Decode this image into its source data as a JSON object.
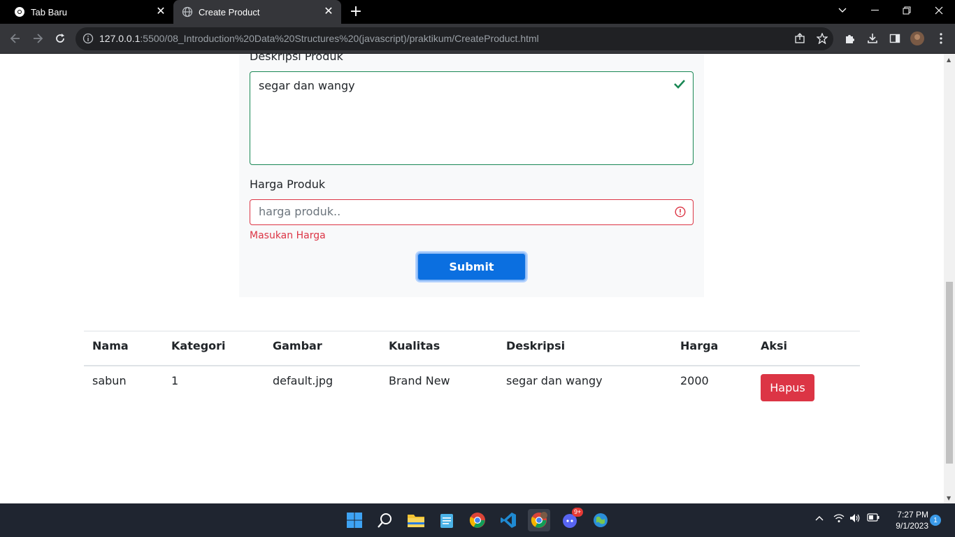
{
  "browser": {
    "tabs": [
      {
        "label": "Tab Baru"
      },
      {
        "label": "Create Product"
      }
    ],
    "url_host": "127.0.0.1",
    "url_rest": ":5500/08_Introduction%20Data%20Structures%20(javascript)/praktikum/CreateProduct.html"
  },
  "form": {
    "desc_label": "Deskripsi Produk",
    "desc_value": "segar dan wangy",
    "price_label": "Harga Produk",
    "price_placeholder": "harga produk..",
    "price_feedback": "Masukan Harga",
    "submit_label": "Submit",
    "colors": {
      "valid": "#198754",
      "invalid": "#dc3545",
      "primary": "#0b6fe0"
    }
  },
  "table": {
    "headers": [
      "Nama",
      "Kategori",
      "Gambar",
      "Kualitas",
      "Deskripsi",
      "Harga",
      "Aksi"
    ],
    "rows": [
      {
        "nama": "sabun",
        "kategori": "1",
        "gambar": "default.jpg",
        "kualitas": "Brand New",
        "deskripsi": "segar dan wangy",
        "harga": "2000",
        "aksi": "Hapus"
      }
    ]
  },
  "taskbar": {
    "time": "7:27 PM",
    "date": "9/1/2023",
    "notification_count": "1",
    "discord_badge": "9+"
  }
}
